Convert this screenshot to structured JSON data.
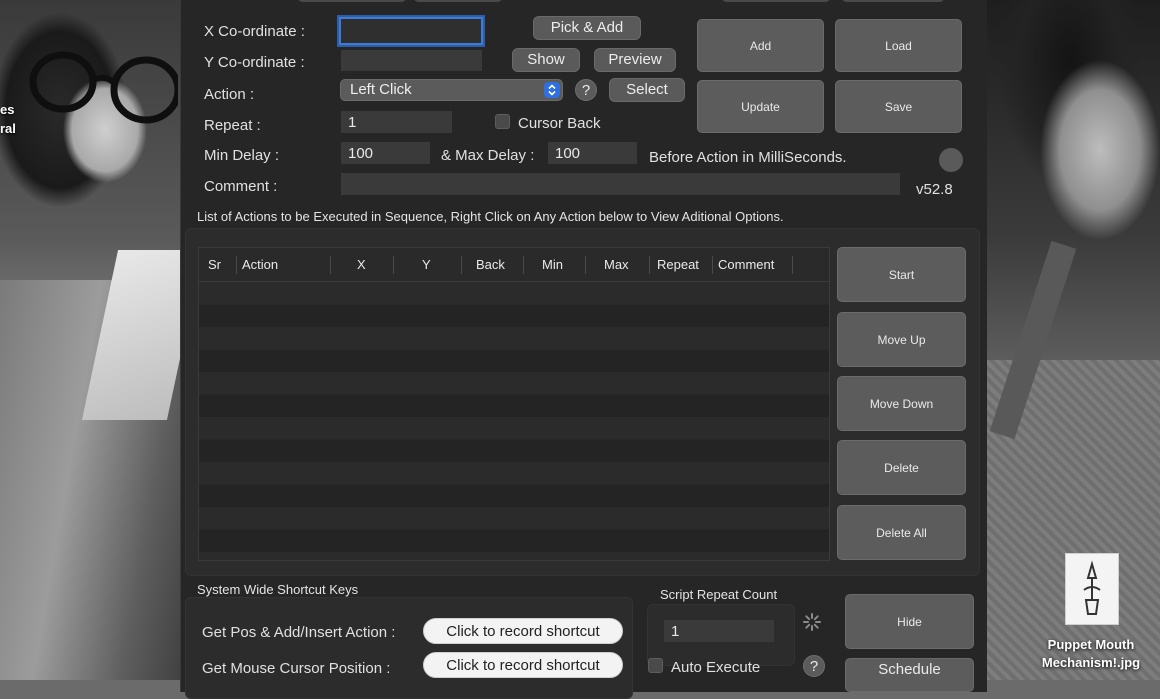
{
  "desktop": {
    "left_label_lines": [
      "es",
      "ral"
    ],
    "file_name_lines": [
      "Puppet Mouth",
      "Mechanism!.jpg"
    ]
  },
  "form": {
    "x_label": "X Co-ordinate :",
    "x_value": "",
    "y_label": "Y Co-ordinate :",
    "y_value": "",
    "action_label": "Action :",
    "action_value": "Left Click",
    "repeat_label": "Repeat :",
    "repeat_value": "1",
    "cursor_back_label": "Cursor Back",
    "min_delay_label": "Min Delay :",
    "min_delay_value": "100",
    "max_delay_label": "& Max Delay :",
    "max_delay_value": "100",
    "delay_note": "Before Action in MilliSeconds.",
    "comment_label": "Comment :",
    "comment_value": "",
    "version": "v52.8"
  },
  "buttons": {
    "pick_add": "Pick & Add",
    "show": "Show",
    "preview": "Preview",
    "help": "?",
    "select": "Select",
    "add": "Add",
    "load": "Load",
    "update": "Update",
    "save": "Save",
    "start": "Start",
    "move_up": "Move Up",
    "move_down": "Move Down",
    "delete": "Delete",
    "delete_all": "Delete All",
    "hide": "Hide",
    "schedule": "Schedule"
  },
  "actions_list": {
    "caption": "List of Actions to be Executed in Sequence, Right Click on Any Action below to View Aditional Options.",
    "columns": [
      "Sr",
      "Action",
      "X",
      "Y",
      "Back",
      "Min",
      "Max",
      "Repeat",
      "Comment"
    ],
    "rows": []
  },
  "shortcuts": {
    "title": "System Wide Shortcut Keys",
    "items": [
      {
        "label": "Get Pos & Add/Insert Action :",
        "button": "Click to record shortcut"
      },
      {
        "label": "Get Mouse Cursor Position :",
        "button": "Click to record shortcut"
      }
    ]
  },
  "script": {
    "repeat_title": "Script Repeat Count",
    "repeat_value": "1",
    "auto_execute_label": "Auto Execute"
  },
  "colors": {
    "window_bg": "#262626",
    "focus_ring": "#3d7bd9",
    "dropdown_accent": "#2f6fe0"
  }
}
